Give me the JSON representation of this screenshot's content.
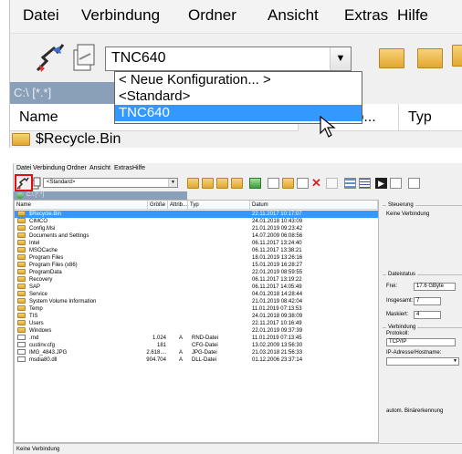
{
  "zoom": {
    "menu": [
      "Datei",
      "Verbindung",
      "Ordner",
      "Ansicht",
      "Extras",
      "Hilfe"
    ],
    "combo_value": "TNC640",
    "dropdown": [
      "< Neue Konfiguration... >",
      "<Standard>",
      "TNC640"
    ],
    "path": "C:\\ [*.*]",
    "columns": [
      "Name",
      "Attrib...",
      "Typ"
    ],
    "first_row": "$Recycle.Bin"
  },
  "window": {
    "menu": [
      "Datei",
      "Verbindung",
      "Ordner",
      "Ansicht",
      "Extras",
      "Hilfe"
    ],
    "combo_value": "<Standard>",
    "path": "C:\\ [*.*]",
    "columns": [
      "Name",
      "Größe",
      "Attrib...",
      "Typ",
      "Datum"
    ],
    "files": [
      {
        "name": "$Recycle.Bin",
        "size": "",
        "attr": "",
        "type": "",
        "date": "22.11.2017 10:17:07",
        "kind": "folder"
      },
      {
        "name": "CIMCO",
        "size": "",
        "attr": "",
        "type": "",
        "date": "24.01.2018 10:43:09",
        "kind": "folder"
      },
      {
        "name": "Config.Msi",
        "size": "",
        "attr": "",
        "type": "",
        "date": "21.01.2019 09:23:42",
        "kind": "folder"
      },
      {
        "name": "Documents and Settings",
        "size": "",
        "attr": "",
        "type": "",
        "date": "14.07.2009 06:08:56",
        "kind": "folder"
      },
      {
        "name": "Intel",
        "size": "",
        "attr": "",
        "type": "",
        "date": "06.11.2017 13:24:40",
        "kind": "folder"
      },
      {
        "name": "MSOCache",
        "size": "",
        "attr": "",
        "type": "",
        "date": "06.11.2017 13:38:21",
        "kind": "folder"
      },
      {
        "name": "Program Files",
        "size": "",
        "attr": "",
        "type": "",
        "date": "18.01.2019 13:26:16",
        "kind": "folder"
      },
      {
        "name": "Program Files (x86)",
        "size": "",
        "attr": "",
        "type": "",
        "date": "15.01.2019 16:28:27",
        "kind": "folder"
      },
      {
        "name": "ProgramData",
        "size": "",
        "attr": "",
        "type": "",
        "date": "22.01.2019 08:59:55",
        "kind": "folder"
      },
      {
        "name": "Recovery",
        "size": "",
        "attr": "",
        "type": "",
        "date": "06.11.2017 13:19:22",
        "kind": "folder"
      },
      {
        "name": "SAP",
        "size": "",
        "attr": "",
        "type": "",
        "date": "06.11.2017 14:05:49",
        "kind": "folder"
      },
      {
        "name": "Service",
        "size": "",
        "attr": "",
        "type": "",
        "date": "04.01.2018 14:28:44",
        "kind": "folder"
      },
      {
        "name": "System Volume Information",
        "size": "",
        "attr": "",
        "type": "",
        "date": "21.01.2019 08:42:04",
        "kind": "folder"
      },
      {
        "name": "Temp",
        "size": "",
        "attr": "",
        "type": "",
        "date": "11.01.2019 07:13:53",
        "kind": "folder"
      },
      {
        "name": "TIS",
        "size": "",
        "attr": "",
        "type": "",
        "date": "24.01.2018 09:38:09",
        "kind": "folder"
      },
      {
        "name": "Users",
        "size": "",
        "attr": "",
        "type": "",
        "date": "22.11.2017 10:16:49",
        "kind": "folder"
      },
      {
        "name": "Windows",
        "size": "",
        "attr": "",
        "type": "",
        "date": "22.01.2019 09:37:39",
        "kind": "folder"
      },
      {
        "name": ".rnd",
        "size": "1.024",
        "attr": "A",
        "type": "RND-Datei",
        "date": "11.01.2019 07:13:45",
        "kind": "file"
      },
      {
        "name": "custinv.cfg",
        "size": "181",
        "attr": "",
        "type": "CFG-Datei",
        "date": "13.02.2009 13:56:30",
        "kind": "file"
      },
      {
        "name": "IMG_4843.JPG",
        "size": "2.618....",
        "attr": "A",
        "type": "JPG-Datei",
        "date": "21.03.2018 21:56:33",
        "kind": "file"
      },
      {
        "name": "msdia80.dll",
        "size": "904.704",
        "attr": "A",
        "type": "DLL-Datei",
        "date": "01.12.2006 23:37:14",
        "kind": "file"
      }
    ],
    "panel": {
      "steuerung_title": "Steuerung",
      "steuerung_text": "Keine Verbindung",
      "dateistatus_title": "Dateistatus",
      "frei_label": "Frei:",
      "frei_value": "17.6 GByte",
      "insgesamt_label": "Insgesamt:",
      "insgesamt_value": "7",
      "maskiert_label": "Maskiert:",
      "maskiert_value": "4",
      "verbindung_title": "Verbindung",
      "protokoll_label": "Protokoll:",
      "protokoll_value": "TCP/IP",
      "ip_label": "IP-Adresse/Hostname:",
      "binary_label": "autom. Binärerkennung"
    },
    "status": "Keine Verbindung"
  },
  "colors": {
    "selection": "#3399ff",
    "highlight_box": "#e01010",
    "path_bar": "#8aa0b8"
  }
}
